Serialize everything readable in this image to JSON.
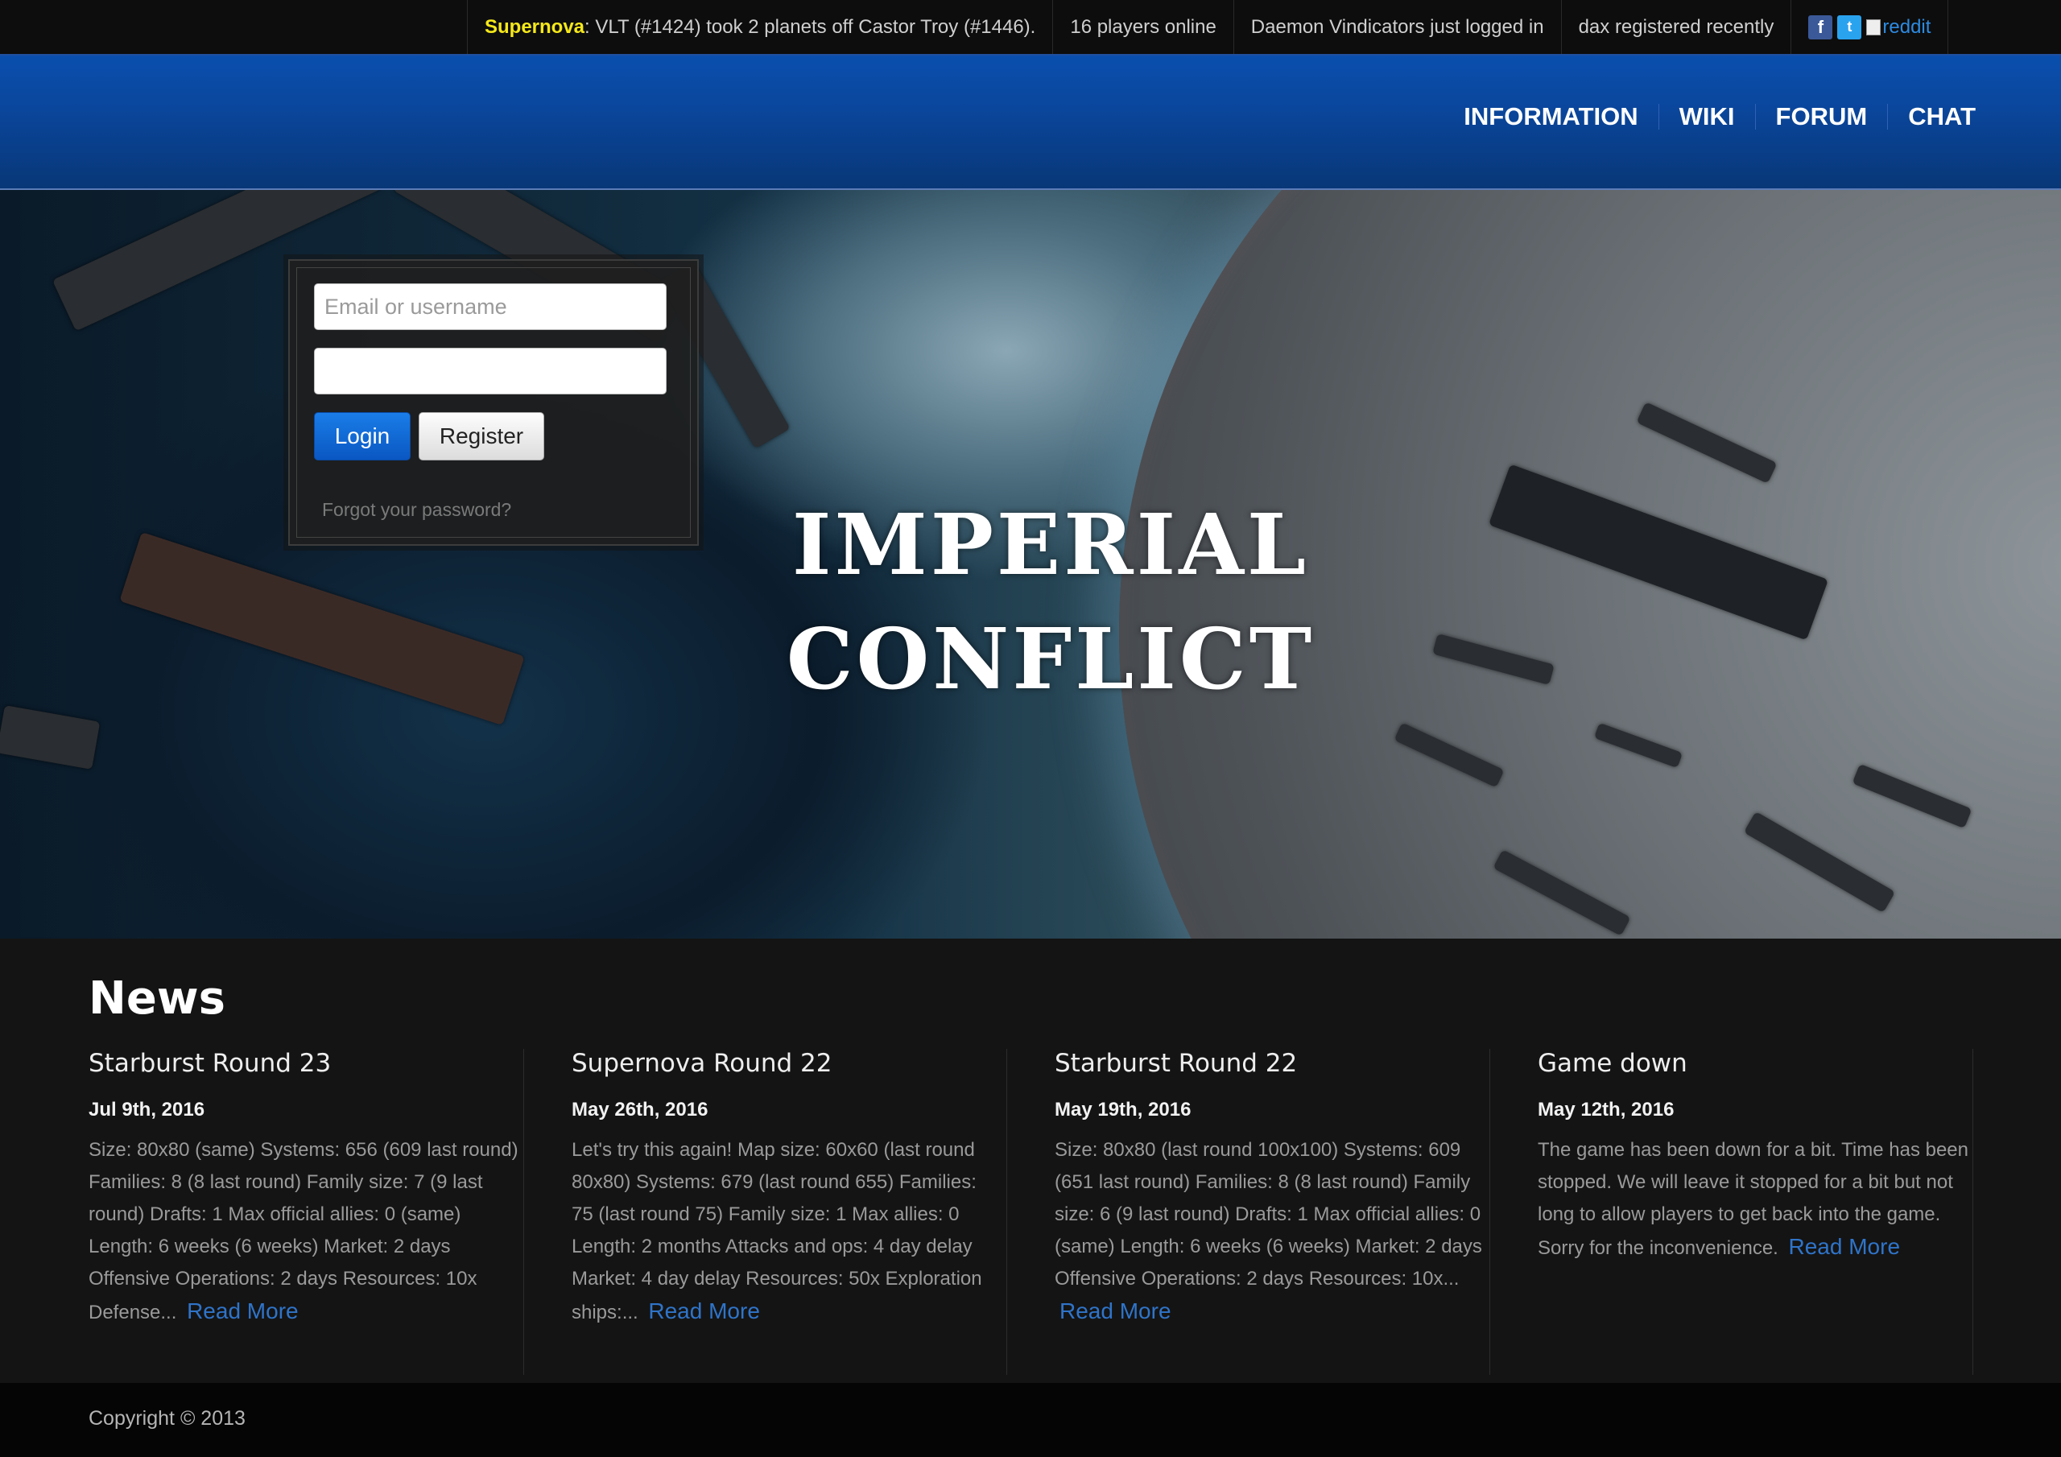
{
  "ticker": {
    "event_game": "Supernova",
    "event_text": ": VLT (#1424) took 2 planets off Castor Troy (#1446).",
    "players_online": "16 players online",
    "login_event": "Daemon Vindicators just logged in",
    "register_event": "dax registered recently",
    "reddit_label": "reddit"
  },
  "nav": {
    "items": [
      "INFORMATION",
      "WIKI",
      "FORUM",
      "CHAT"
    ]
  },
  "hero": {
    "logo_line1": "IMPERIAL",
    "logo_line2": "CONFLICT"
  },
  "login": {
    "username_placeholder": "Email or username",
    "login_button": "Login",
    "register_button": "Register",
    "forgot_link": "Forgot your password?"
  },
  "news": {
    "heading": "News",
    "items": [
      {
        "title": "Starburst Round 23",
        "date": "Jul 9th, 2016",
        "body": "Size: 80x80 (same) Systems: 656 (609 last round) Families: 8 (8 last round) Family size: 7 (9 last round) Drafts: 1 Max official allies: 0 (same) Length: 6 weeks (6 weeks) Market: 2 days Offensive Operations: 2 days Resources: 10x Defense...",
        "read_more": "Read More"
      },
      {
        "title": "Supernova Round 22",
        "date": "May 26th, 2016",
        "body": "Let's try this again! Map size: 60x60 (last round 80x80) Systems: 679 (last round 655) Families: 75 (last round 75) Family size: 1 Max allies: 0 Length: 2 months Attacks and ops: 4 day delay Market: 4 day delay Resources: 50x Exploration ships:...",
        "read_more": "Read More"
      },
      {
        "title": "Starburst Round 22",
        "date": "May 19th, 2016",
        "body": "Size: 80x80 (last round 100x100) Systems: 609 (651 last round) Families: 8 (8 last round) Family size: 6 (9 last round) Drafts: 1 Max official allies: 0 (same) Length: 6 weeks (6 weeks) Market: 2 days Offensive Operations: 2 days Resources: 10x...",
        "read_more": "Read More"
      },
      {
        "title": "Game down",
        "date": "May 12th, 2016",
        "body": "The game has been down for a bit. Time has been stopped. We will leave it stopped for a bit but not long to allow players to get back into the game. Sorry for the inconvenience.",
        "read_more": "Read More"
      }
    ]
  },
  "footer": {
    "copyright": "Copyright © 2013"
  },
  "icons": {
    "facebook": "facebook-icon",
    "twitter": "twitter-icon",
    "reddit": "reddit-broken-image-icon"
  },
  "colors": {
    "accent": "#0a4fae",
    "highlight": "#f5e81a",
    "link": "#2f74c9"
  }
}
